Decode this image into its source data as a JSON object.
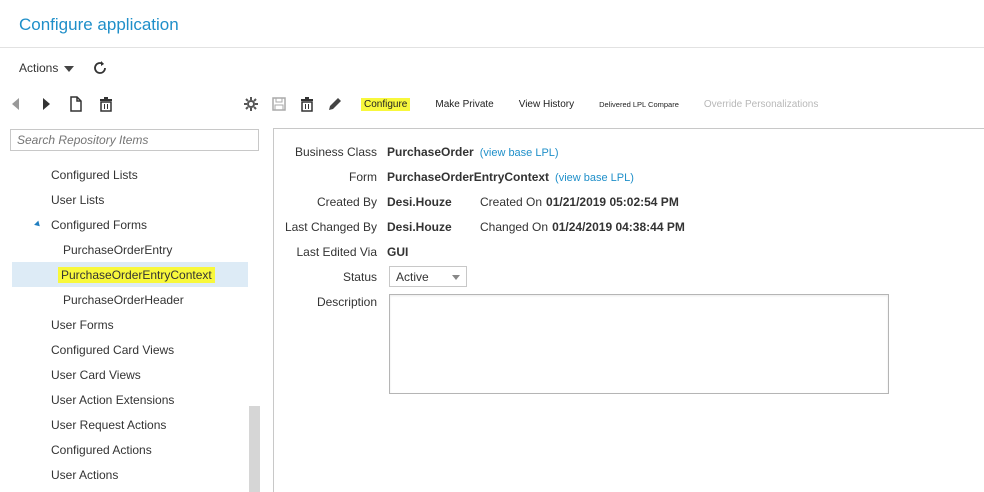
{
  "app": {
    "title": "Configure application"
  },
  "actions": {
    "label": "Actions"
  },
  "toolbar": {
    "configure": "Configure",
    "make_private": "Make Private",
    "view_history": "View History",
    "delivered_compare": "Delivered LPL Compare",
    "override": "Override Personalizations"
  },
  "search": {
    "placeholder": "Search Repository Items"
  },
  "tree": {
    "items": [
      "Configured Lists",
      "User Lists",
      "Configured Forms",
      "PurchaseOrderEntry",
      "PurchaseOrderEntryContext",
      "PurchaseOrderHeader",
      "User Forms",
      "Configured Card Views",
      "User Card Views",
      "User Action Extensions",
      "User Request Actions",
      "Configured Actions",
      "User Actions"
    ]
  },
  "details": {
    "business_class_label": "Business Class",
    "business_class_value": "PurchaseOrder",
    "business_class_link": "(view base LPL)",
    "form_label": "Form",
    "form_value": "PurchaseOrderEntryContext",
    "form_link": "(view base LPL)",
    "created_by_label": "Created By",
    "created_by_value": "Desi.Houze",
    "created_on_label": "Created On",
    "created_on_value": "01/21/2019 05:02:54 PM",
    "last_changed_by_label": "Last Changed By",
    "last_changed_by_value": "Desi.Houze",
    "changed_on_label": "Changed On",
    "changed_on_value": "01/24/2019 04:38:44 PM",
    "last_edited_via_label": "Last Edited Via",
    "last_edited_via_value": "GUI",
    "status_label": "Status",
    "status_value": "Active",
    "description_label": "Description"
  },
  "colors": {
    "accent": "#1f8fc9",
    "highlight": "#f8f83c",
    "selection": "#ddebf6"
  }
}
